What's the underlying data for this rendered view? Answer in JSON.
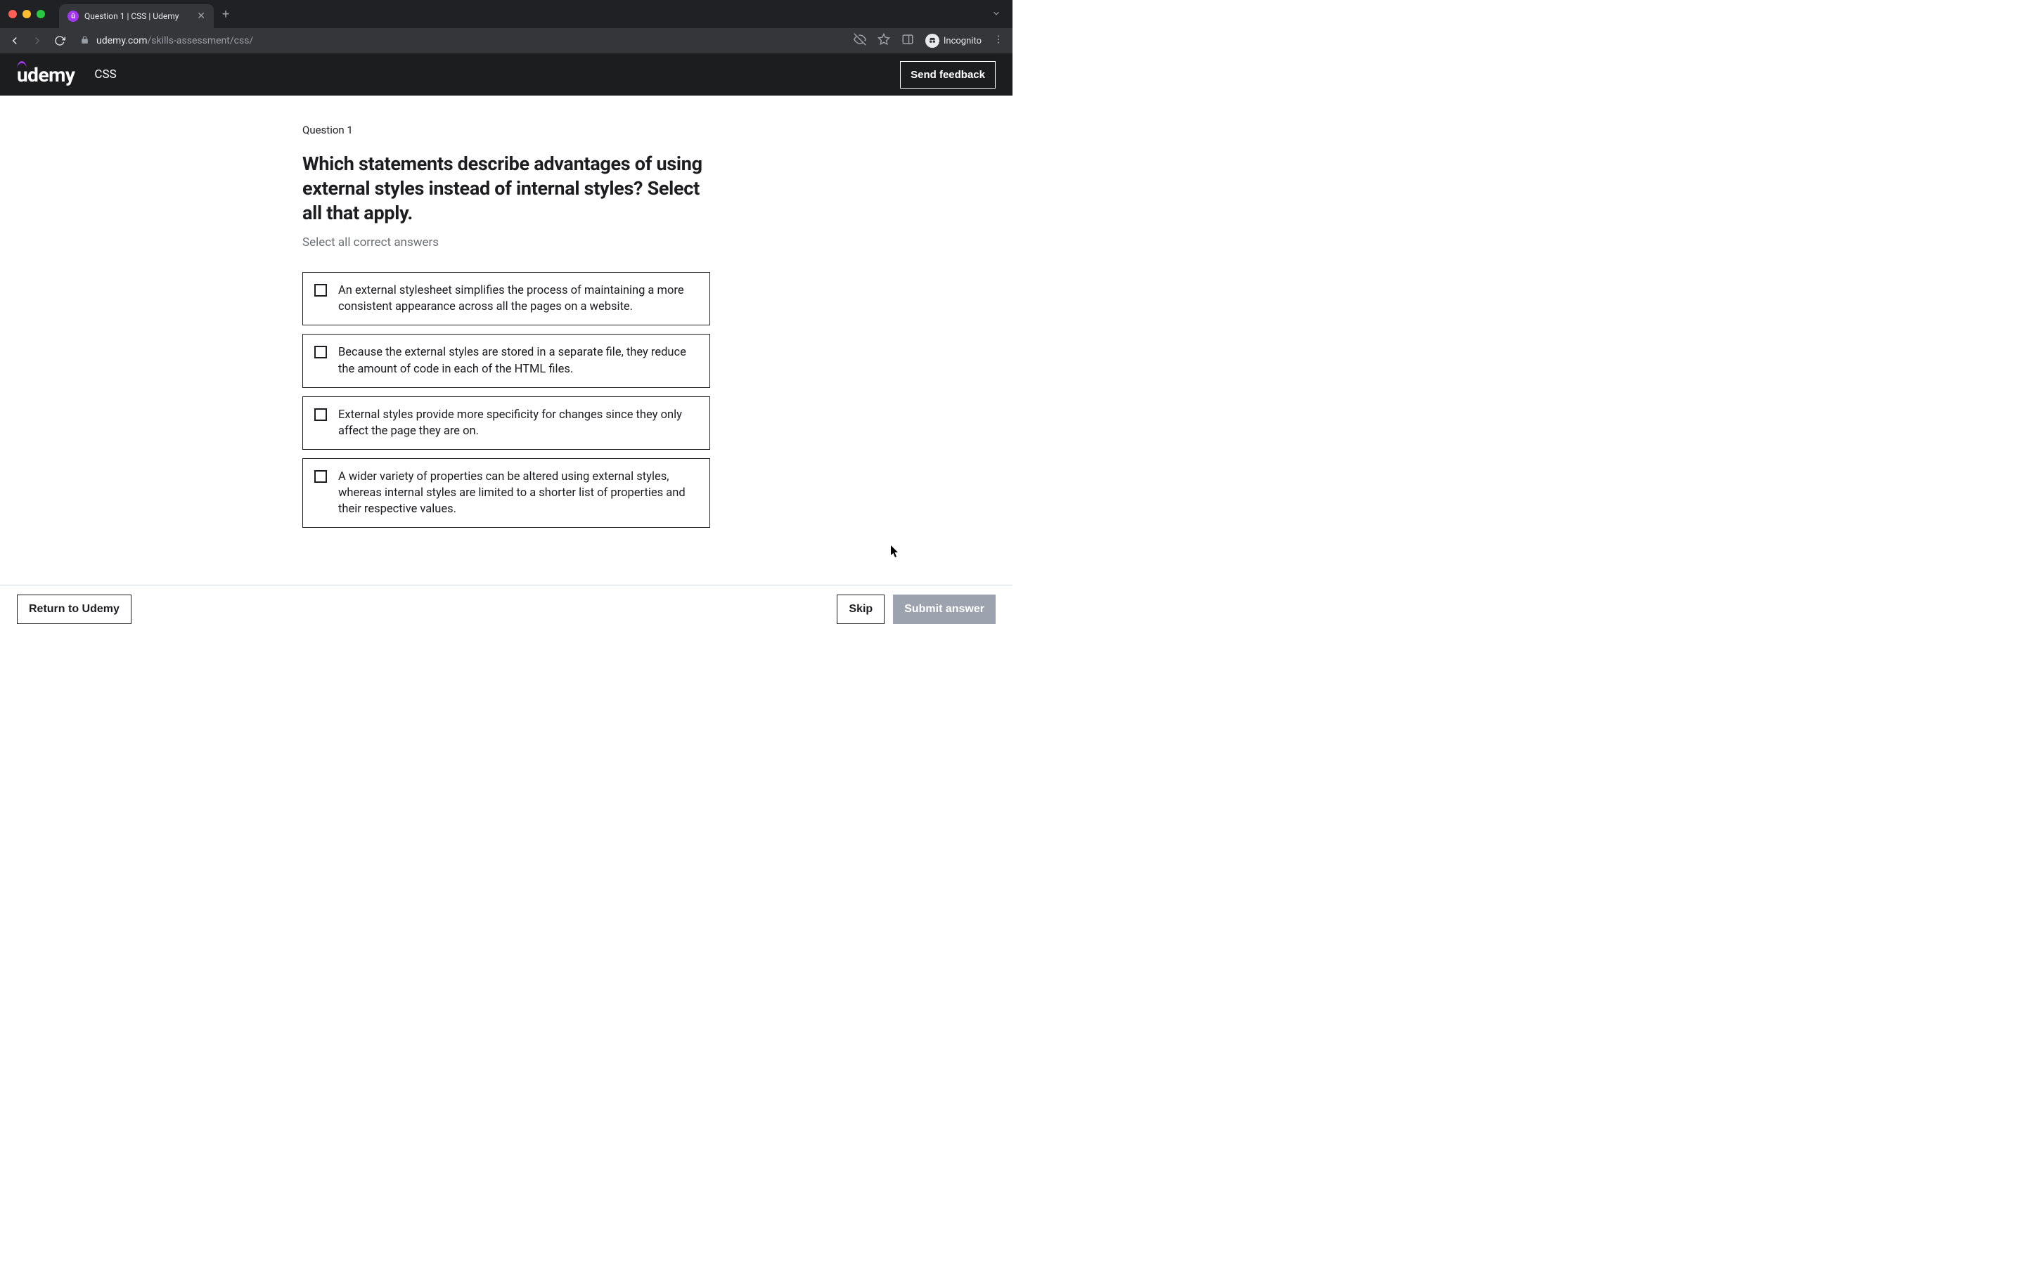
{
  "browser": {
    "tab_title": "Question 1 | CSS | Udemy",
    "url_domain": "udemy.com",
    "url_path": "/skills-assessment/css/",
    "incognito_label": "Incognito"
  },
  "header": {
    "logo_text": "udemy",
    "course_title": "CSS",
    "feedback_label": "Send feedback"
  },
  "question": {
    "number_label": "Question 1",
    "text": "Which statements describe advantages of using external styles instead of internal styles? Select all that apply.",
    "hint": "Select all correct answers",
    "options": [
      "An external stylesheet simplifies the process of maintaining a more consistent appearance across all the pages on a website.",
      "Because the external styles are stored in a separate file, they reduce the amount of code in each of the HTML files.",
      "External styles provide more specificity for changes since they only affect the page they are on.",
      "A wider variety of properties can be altered using external styles, whereas internal styles are limited to a shorter list of properties and their respective values."
    ]
  },
  "footer": {
    "return_label": "Return to Udemy",
    "skip_label": "Skip",
    "submit_label": "Submit answer"
  }
}
